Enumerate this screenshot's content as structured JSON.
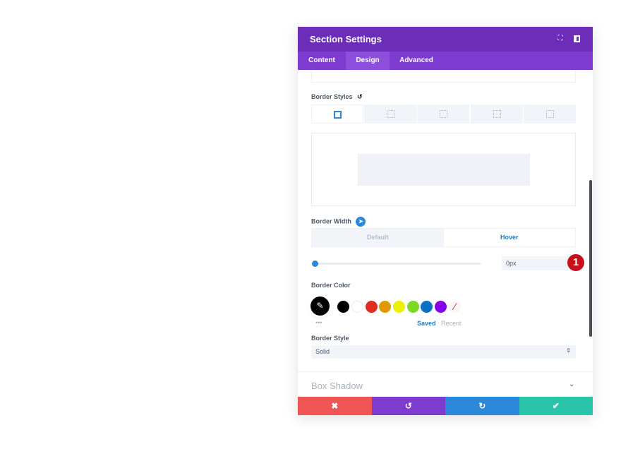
{
  "header": {
    "title": "Section Settings",
    "icons": [
      "fullscreen-icon",
      "sidebar-toggle-icon"
    ]
  },
  "tabs": [
    {
      "label": "Content"
    },
    {
      "label": "Design",
      "active": true
    },
    {
      "label": "Advanced"
    }
  ],
  "border_styles": {
    "label": "Border Styles",
    "options": [
      "all",
      "top",
      "right",
      "bottom",
      "left"
    ],
    "selected": "all"
  },
  "border_width": {
    "label": "Border Width",
    "modes": [
      "Default",
      "Hover"
    ],
    "active_mode": "Hover",
    "value": "0px",
    "slider_fraction": 0,
    "badge": "1"
  },
  "border_color": {
    "label": "Border Color",
    "swatches": [
      "#000000",
      "#ffffff",
      "#e02b20",
      "#e09900",
      "#edf000",
      "#7cda24",
      "#0c71c3",
      "#8300e9"
    ],
    "selected": "#000000",
    "more": "•••",
    "saved": "Saved",
    "recent": "Recent"
  },
  "border_style": {
    "label": "Border Style",
    "value": "Solid"
  },
  "box_shadow": {
    "label": "Box Shadow"
  },
  "footer": {
    "cancel": "✖",
    "undo": "↺",
    "redo": "↻",
    "save": "✔"
  },
  "colors": {
    "header": "#6c2eb9",
    "tabs": "#7e3bd0",
    "cancel": "#ef5555",
    "undo": "#7e3bd0",
    "redo": "#2b87da",
    "save": "#29c4a9"
  }
}
